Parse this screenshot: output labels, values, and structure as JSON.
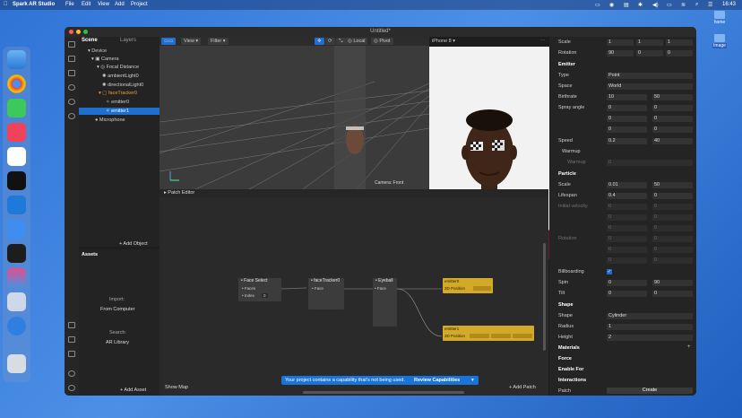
{
  "menubar": {
    "app_name": "Spark AR Studio",
    "menus": [
      "File",
      "Edit",
      "View",
      "Add",
      "Project"
    ],
    "time": "16:43"
  },
  "desktop": {
    "home_label": "home",
    "image_label": "Image"
  },
  "window": {
    "title": "Untitled*"
  },
  "scene": {
    "tabs": [
      "Scene",
      "Layers"
    ],
    "items": [
      "Device",
      "Camera",
      "Focal Distance",
      "ambientLight0",
      "directionalLight0",
      "faceTracker0",
      "emitter0",
      "emitter1",
      "Microphone"
    ],
    "add_object": "+ Add Object"
  },
  "assets": {
    "title": "Assets",
    "import_label": "Import:",
    "from_computer": "From Computer",
    "search_label": "Search:",
    "ar_library": "AR Library",
    "add_asset": "+ Add Asset"
  },
  "viewport": {
    "view_btn": "View",
    "filter_btn": "Filter",
    "local_btn": "Local",
    "pivot_btn": "Pivot",
    "camera_label": "Camera: Front"
  },
  "simulator": {
    "device": "iPhone 8"
  },
  "patch": {
    "title": "Patch Editor",
    "show_map": "Show Map",
    "add_patch": "+ Add Patch",
    "nodes": {
      "face_select": {
        "title": "Face Select",
        "ports": [
          "Faces",
          "Index"
        ],
        "index_value": "0"
      },
      "face_tracker": {
        "title": "faceTracker0",
        "ports": [
          "Face"
        ]
      },
      "eyeball": {
        "title": "Eyeball",
        "ports": [
          "Face"
        ]
      },
      "emitter0": {
        "title": "emitter0",
        "port": "3D Position"
      },
      "emitter1": {
        "title": "emitter1",
        "port": "3D Position"
      }
    }
  },
  "toast": {
    "message": "Your project contains a capability that's not being used.",
    "action": "Review Capabilities"
  },
  "inspector": {
    "scale_label": "Scale",
    "scale_values": [
      "1",
      "1",
      "1"
    ],
    "rotation_label": "Rotation",
    "rotation_values": [
      "90",
      "0",
      "0"
    ],
    "emitter_section": "Emitter",
    "type_label": "Type",
    "type_value": "Point",
    "space_label": "Space",
    "space_value": "World",
    "birthrate_label": "Birthrate",
    "birthrate_values": [
      "10",
      "50"
    ],
    "spray_label": "Spray angle",
    "spray_values": [
      "0",
      "0",
      "0",
      "0",
      "0",
      "0"
    ],
    "speed_label": "Speed",
    "speed_values": [
      "0.2",
      "40"
    ],
    "warmup_label": "Warmup",
    "warmup_sub": "Warmup",
    "warmup_value": "0",
    "particle_section": "Particle",
    "p_scale_label": "Scale",
    "p_scale_values": [
      "0.01",
      "50"
    ],
    "lifespan_label": "Lifespan",
    "lifespan_values": [
      "0.4",
      "0"
    ],
    "initial_velocity_label": "Initial velocity",
    "initial_velocity_values": [
      "0",
      "0",
      "0",
      "0",
      "0",
      "0"
    ],
    "rotation2_label": "Rotation",
    "rotation2_values": [
      "0",
      "0",
      "0",
      "0",
      "0",
      "0"
    ],
    "billboarding_label": "Billboarding",
    "spin_label": "Spin",
    "spin_values": [
      "0",
      "90"
    ],
    "tilt_label": "Tilt",
    "tilt_values": [
      "0",
      "0"
    ],
    "shape_section": "Shape",
    "shape_label": "Shape",
    "shape_value": "Cylinder",
    "radius_label": "Radius",
    "radius_value": "1",
    "height_label": "Height",
    "height_value": "2",
    "materials_label": "Materials",
    "force_label": "Force",
    "enable_for_label": "Enable For",
    "interactions_label": "Interactions",
    "patch_label": "Patch",
    "create_btn": "Create"
  }
}
